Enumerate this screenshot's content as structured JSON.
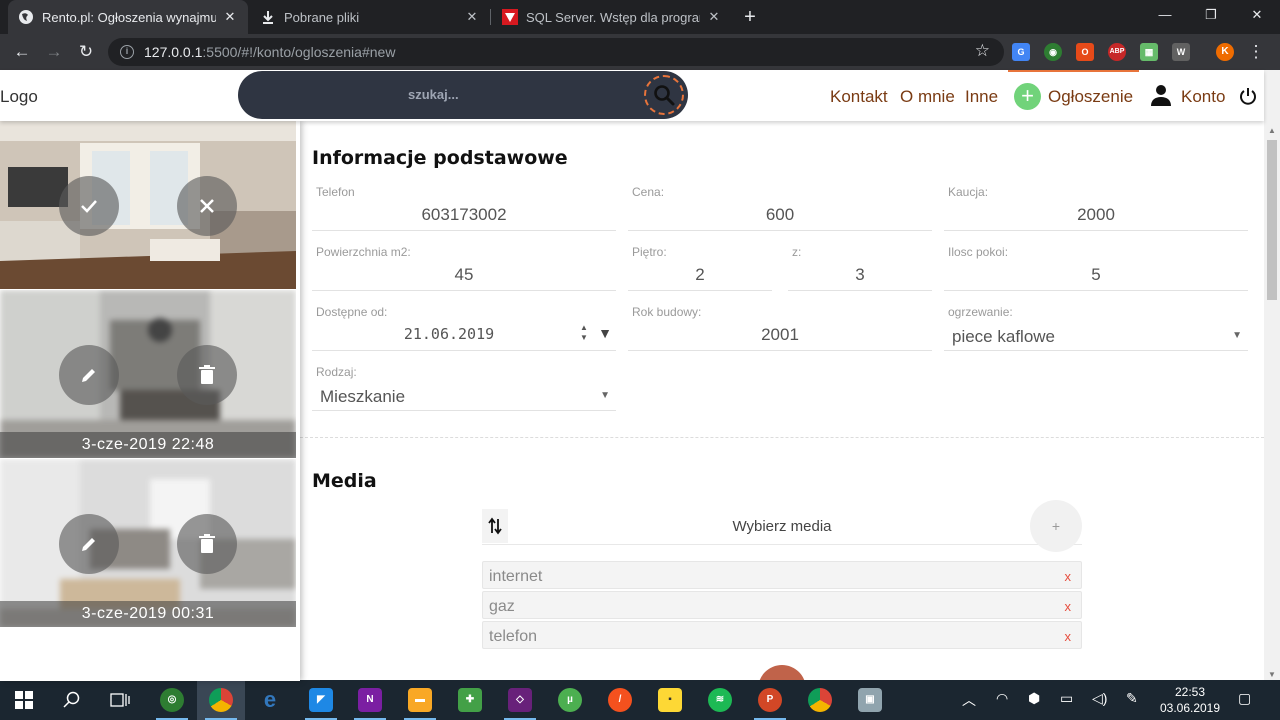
{
  "browser": {
    "tabs": [
      {
        "title": "Rento.pl: Ogłoszenia wynajmu ni",
        "close": "✕"
      },
      {
        "title": "Pobrane pliki",
        "close": "✕"
      },
      {
        "title": "SQL Server. Wstęp dla programis",
        "close": "✕"
      }
    ],
    "newtab": "+",
    "url_host": "127.0.0.1",
    "url_rest": ":5500/#!/konto/ogloszenia#new",
    "profile_initial": "K"
  },
  "header": {
    "logo": "Logo",
    "search_placeholder": "szukaj...",
    "nav": {
      "kontakt": "Kontakt",
      "omnie": "O mnie",
      "inne": "Inne",
      "ogloszenie": "Ogłoszenie",
      "konto": "Konto"
    }
  },
  "listings": [
    {
      "date": ""
    },
    {
      "date": "3-cze-2019 22:48"
    },
    {
      "date": "3-cze-2019 00:31"
    }
  ],
  "form": {
    "section_basic": "Informacje podstawowe",
    "telefon": {
      "label": "Telefon",
      "value": "603173002"
    },
    "cena": {
      "label": "Cena:",
      "value": "600"
    },
    "kaucja": {
      "label": "Kaucja:",
      "value": "2000"
    },
    "powierzchnia": {
      "label": "Powierzchnia m2:",
      "value": "45"
    },
    "pietro": {
      "label": "Piętro:",
      "value": "2"
    },
    "z": {
      "label": "z:",
      "value": "3"
    },
    "pokoje": {
      "label": "Ilosc pokoi:",
      "value": "5"
    },
    "dostepne": {
      "label": "Dostępne od:",
      "value": "21.06.2019"
    },
    "rok": {
      "label": "Rok budowy:",
      "value": "2001"
    },
    "ogrzewanie": {
      "label": "ogrzewanie:",
      "value": "piece kaflowe"
    },
    "rodzaj": {
      "label": "Rodzaj:",
      "value": "Mieszkanie"
    },
    "section_media": "Media",
    "media_select": "Wybierz media",
    "media_add": "+",
    "media_items": [
      {
        "name": "internet",
        "remove": "x"
      },
      {
        "name": "gaz",
        "remove": "x"
      },
      {
        "name": "telefon",
        "remove": "x"
      }
    ]
  },
  "taskbar": {
    "time": "22:53",
    "date": "03.06.2019"
  }
}
